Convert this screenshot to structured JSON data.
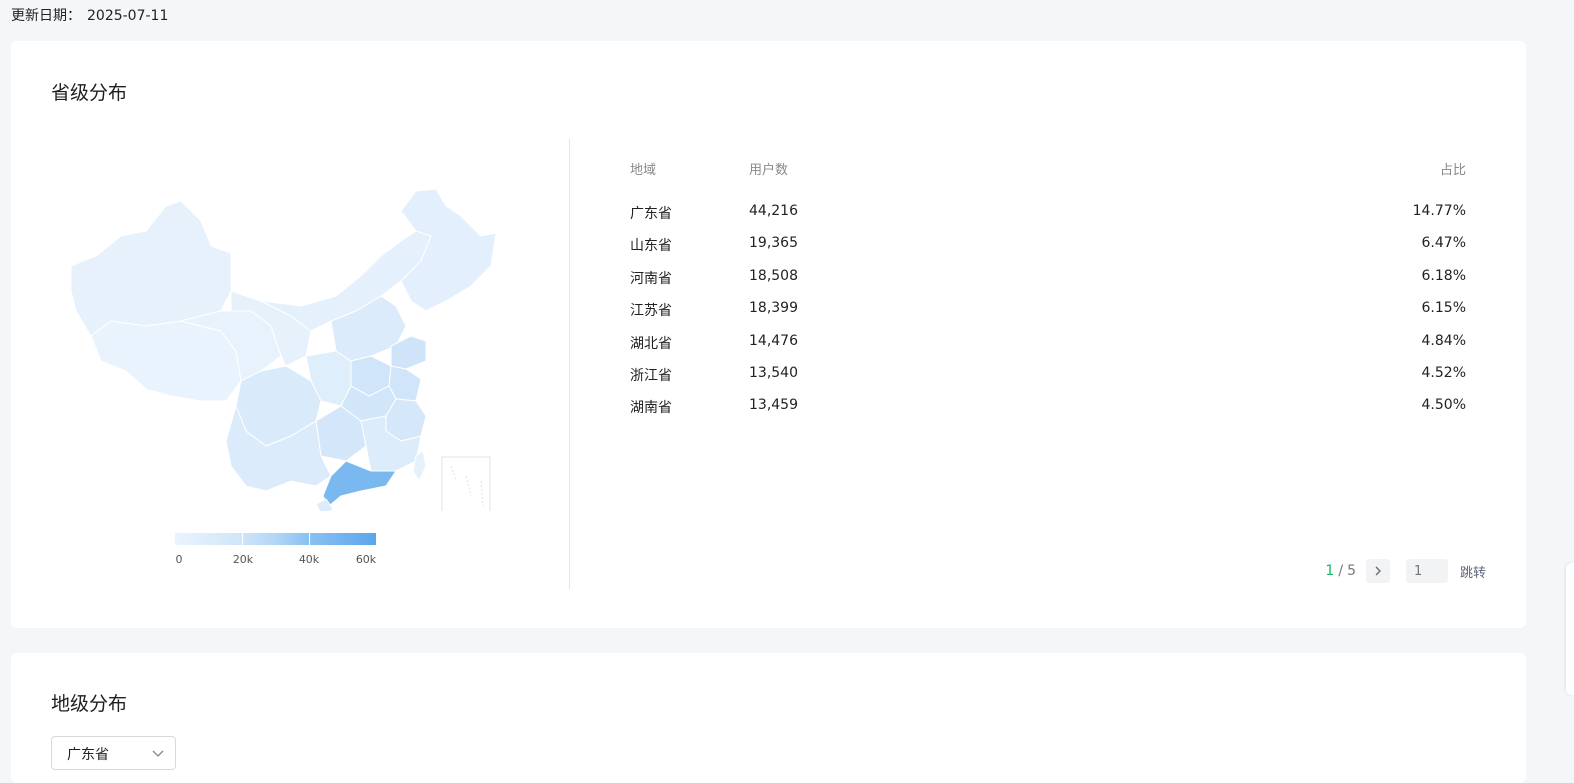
{
  "header": {
    "date_label": "更新日期：",
    "date_value": "2025-07-11"
  },
  "province_section": {
    "title": "省级分布",
    "legend": {
      "ticks": [
        "0",
        "20k",
        "40k",
        "60k"
      ]
    },
    "table": {
      "columns": {
        "region": "地域",
        "users": "用户数",
        "ratio": "占比"
      },
      "rows": [
        {
          "region": "广东省",
          "users": "44,216",
          "ratio": "14.77%"
        },
        {
          "region": "山东省",
          "users": "19,365",
          "ratio": "6.47%"
        },
        {
          "region": "河南省",
          "users": "18,508",
          "ratio": "6.18%"
        },
        {
          "region": "江苏省",
          "users": "18,399",
          "ratio": "6.15%"
        },
        {
          "region": "湖北省",
          "users": "14,476",
          "ratio": "4.84%"
        },
        {
          "region": "浙江省",
          "users": "13,540",
          "ratio": "4.52%"
        },
        {
          "region": "湖南省",
          "users": "13,459",
          "ratio": "4.50%"
        }
      ]
    },
    "pagination": {
      "current": "1",
      "separator": "/",
      "total": "5",
      "input_placeholder": "1",
      "jump_label": "跳转"
    }
  },
  "city_section": {
    "title": "地级分布",
    "select_value": "广东省"
  },
  "colors": {
    "accent_green": "#16b56e",
    "map_high": "#7ab8f0",
    "map_low": "#e8f2fc"
  },
  "icons": {
    "next": "chevron-right-icon",
    "dropdown": "chevron-down-icon"
  }
}
